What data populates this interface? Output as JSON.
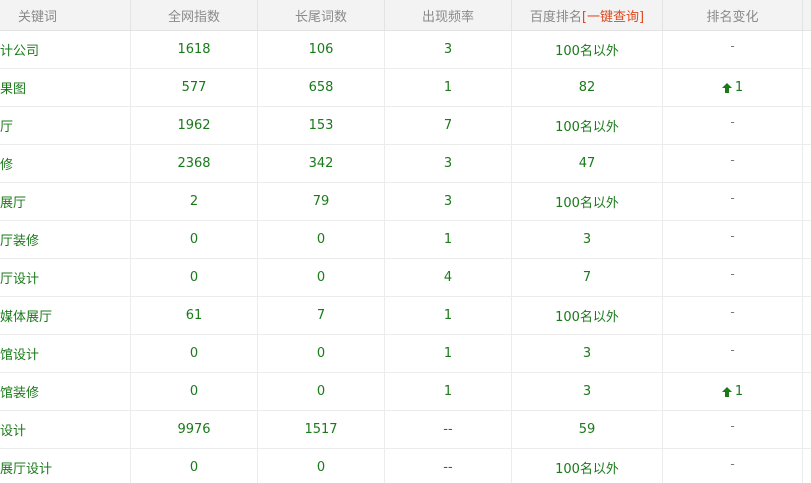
{
  "headers": {
    "keyword": "关键词",
    "total_index": "全网指数",
    "longtail": "长尾词数",
    "frequency": "出现频率",
    "baidu_rank": "百度排名",
    "baidu_rank_link": "[一键查询]",
    "rank_change": "排名变化"
  },
  "rows": [
    {
      "keyword": "计公司",
      "total_index": "1618",
      "longtail": "106",
      "frequency": "3",
      "baidu_rank": "100名以外",
      "change": "-"
    },
    {
      "keyword": "果图",
      "total_index": "577",
      "longtail": "658",
      "frequency": "1",
      "baidu_rank": "82",
      "change": "1"
    },
    {
      "keyword": "厅",
      "total_index": "1962",
      "longtail": "153",
      "frequency": "7",
      "baidu_rank": "100名以外",
      "change": "-"
    },
    {
      "keyword": "修",
      "total_index": "2368",
      "longtail": "342",
      "frequency": "3",
      "baidu_rank": "47",
      "change": "-"
    },
    {
      "keyword": "展厅",
      "total_index": "2",
      "longtail": "79",
      "frequency": "3",
      "baidu_rank": "100名以外",
      "change": "-"
    },
    {
      "keyword": "厅装修",
      "total_index": "0",
      "longtail": "0",
      "frequency": "1",
      "baidu_rank": "3",
      "change": "-"
    },
    {
      "keyword": "厅设计",
      "total_index": "0",
      "longtail": "0",
      "frequency": "4",
      "baidu_rank": "7",
      "change": "-"
    },
    {
      "keyword": "媒体展厅",
      "total_index": "61",
      "longtail": "7",
      "frequency": "1",
      "baidu_rank": "100名以外",
      "change": "-"
    },
    {
      "keyword": "馆设计",
      "total_index": "0",
      "longtail": "0",
      "frequency": "1",
      "baidu_rank": "3",
      "change": "-"
    },
    {
      "keyword": "馆装修",
      "total_index": "0",
      "longtail": "0",
      "frequency": "1",
      "baidu_rank": "3",
      "change": "1"
    },
    {
      "keyword": "设计",
      "total_index": "9976",
      "longtail": "1517",
      "frequency": "--",
      "baidu_rank": "59",
      "change": "-"
    },
    {
      "keyword": "展厅设计",
      "total_index": "0",
      "longtail": "0",
      "frequency": "--",
      "baidu_rank": "100名以外",
      "change": "-"
    }
  ],
  "colors": {
    "value_text": "#1a7a1a",
    "header_text": "#8a8a8a",
    "link": "#e04a1f",
    "header_bg": "#f3f3f3"
  },
  "icons": {
    "up": "arrow-up-icon"
  }
}
